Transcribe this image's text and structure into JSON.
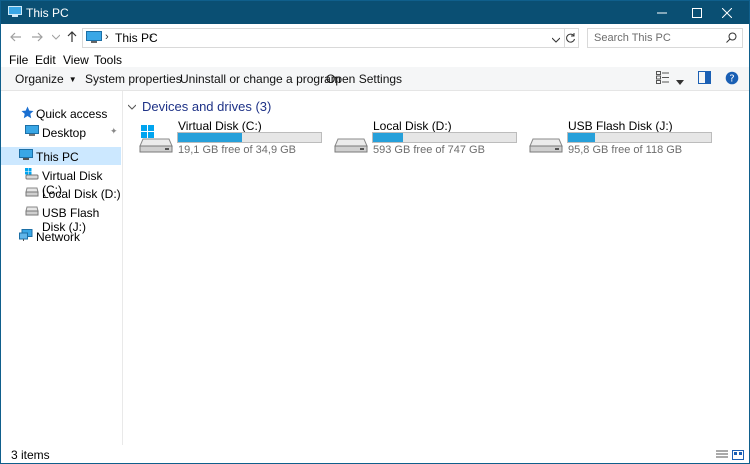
{
  "window": {
    "title": "This PC"
  },
  "address": {
    "crumb": "This PC",
    "search_placeholder": "Search This PC"
  },
  "menu": [
    "File",
    "Edit",
    "View",
    "Tools"
  ],
  "commands": [
    "Organize",
    "System properties",
    "Uninstall or change a program",
    "Open Settings"
  ],
  "sidebar": {
    "items": [
      {
        "label": "Quick access"
      },
      {
        "label": "Desktop"
      },
      {
        "label": "This PC"
      },
      {
        "label": "Virtual Disk (C:)"
      },
      {
        "label": "Local Disk (D:)"
      },
      {
        "label": "USB Flash Disk (J:)"
      },
      {
        "label": "Network"
      }
    ]
  },
  "group": {
    "title": "Devices and drives (3)"
  },
  "drives": [
    {
      "name": "Virtual Disk (C:)",
      "free": "19,1 GB free of 34,9 GB",
      "used_fraction": 0.45
    },
    {
      "name": "Local Disk (D:)",
      "free": "593 GB free of 747 GB",
      "used_fraction": 0.21
    },
    {
      "name": "USB Flash Disk (J:)",
      "free": "95,8 GB free of 118 GB",
      "used_fraction": 0.19
    }
  ],
  "status": {
    "count": "3 items"
  },
  "colors": {
    "titlebar": "#0a4f73",
    "selection": "#cce8ff",
    "accent": "#26a0da",
    "group_header": "#1e3287"
  }
}
